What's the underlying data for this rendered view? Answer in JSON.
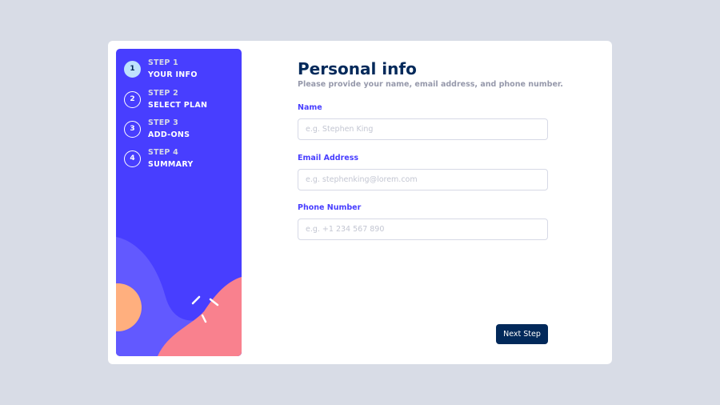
{
  "steps": [
    {
      "number": "1",
      "kicker": "STEP 1",
      "title": "YOUR INFO",
      "active": true
    },
    {
      "number": "2",
      "kicker": "STEP 2",
      "title": "SELECT PLAN",
      "active": false
    },
    {
      "number": "3",
      "kicker": "STEP 3",
      "title": "ADD-ONS",
      "active": false
    },
    {
      "number": "4",
      "kicker": "STEP 4",
      "title": "SUMMARY",
      "active": false
    }
  ],
  "form": {
    "title": "Personal info",
    "subtitle": "Please provide your name, email address, and phone number.",
    "name_label": "Name",
    "name_placeholder": "e.g. Stephen King",
    "email_label": "Email Address",
    "email_placeholder": "e.g. stephenking@lorem.com",
    "phone_label": "Phone Number",
    "phone_placeholder": "e.g. +1 234 567 890"
  },
  "actions": {
    "next_label": "Next Step"
  },
  "colors": {
    "sidebar_bg": "#483eff",
    "active_step": "#bee2fd",
    "title": "#02295a",
    "label": "#483eff",
    "button": "#02295a",
    "page_bg": "#d8dce6"
  }
}
